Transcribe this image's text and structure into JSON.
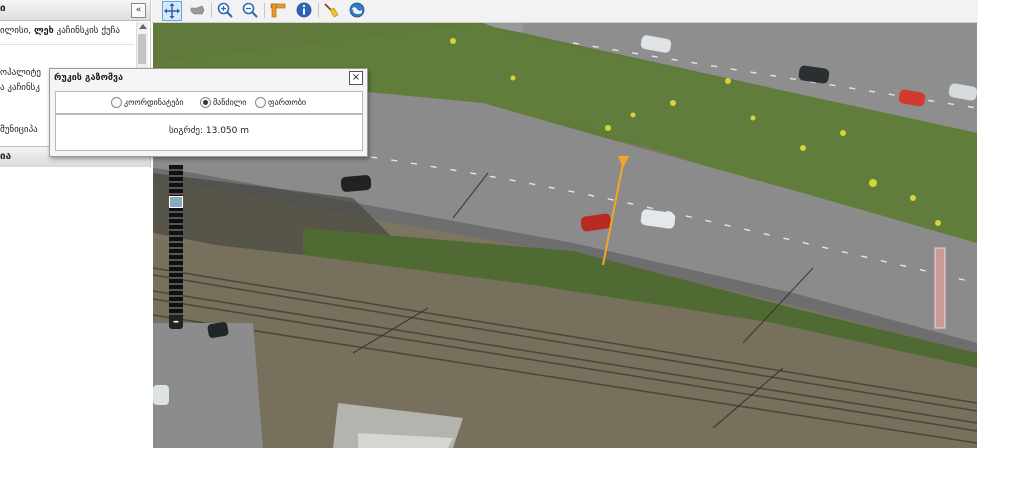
{
  "left_panel": {
    "header": "ი",
    "collapse_symbol": "«",
    "lines": [
      {
        "segments": [
          {
            "text": "ილისი, ",
            "bold": false
          },
          {
            "text": "ლეხ",
            "bold": true
          },
          {
            "text": " კაჩინსკის ქუჩა",
            "bold": false
          }
        ]
      },
      {
        "segments": [
          {
            "text": "ოპალიტე",
            "bold": false
          }
        ]
      },
      {
        "segments": [
          {
            "text": "ა კაჩინსკ",
            "bold": false
          }
        ]
      },
      {
        "segments": [
          {
            "text": "მუნიციპა",
            "bold": false
          }
        ]
      }
    ],
    "footer": "ია"
  },
  "toolbar": {
    "tools": [
      {
        "name": "pan-tool",
        "icon": "pan-arrows-icon",
        "active": true
      },
      {
        "name": "hand-tool",
        "icon": "hand-icon",
        "active": false
      },
      {
        "name": "zoom-in-tool",
        "icon": "zoom-in-icon",
        "active": false
      },
      {
        "name": "zoom-out-tool",
        "icon": "zoom-out-icon",
        "active": false
      },
      {
        "name": "measure-tool",
        "icon": "ruler-icon",
        "active": false
      },
      {
        "name": "info-tool",
        "icon": "info-icon",
        "active": false
      },
      {
        "name": "clear-tool",
        "icon": "broom-icon",
        "active": false
      },
      {
        "name": "globe-tool",
        "icon": "globe-icon",
        "active": false
      }
    ]
  },
  "measure_dialog": {
    "title": "რუკის გაზომვა",
    "close_symbol": "×",
    "options": [
      {
        "label": "კოორდინატები",
        "selected": false
      },
      {
        "label": "მანძილი",
        "selected": true
      },
      {
        "label": "ფართობი",
        "selected": false
      }
    ],
    "result": "სიგრძე: 13.050 m"
  },
  "zoom": {
    "minus_symbol": "–",
    "level_fraction": 0.22
  },
  "colors": {
    "toolbar_active": "#d7e8fb",
    "measure_line": "#f5a623",
    "road": "#8e8e8e",
    "grass": "#5f7a3a"
  }
}
